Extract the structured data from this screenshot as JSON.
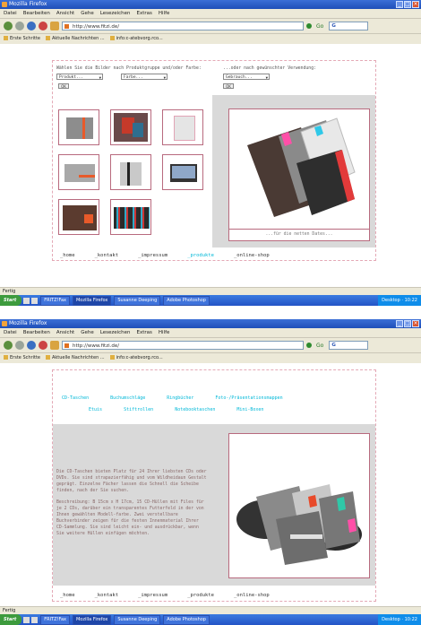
{
  "window": {
    "title": "Mozilla Firefox"
  },
  "menu": [
    "Datei",
    "Bearbeiten",
    "Ansicht",
    "Gehe",
    "Lesezeichen",
    "Extras",
    "Hilfe"
  ],
  "url": "http://www.fitzi.de/",
  "bookmarks": [
    "Erste Schritte",
    "Aktuelle Nachrichten ...",
    "",
    "info:c-atebvorg.rco..."
  ],
  "bookmarks2": [
    "Erste Schritte",
    "Aktuelle Nachrichten ...",
    "info:c-atebvorg.rco..."
  ],
  "status_label": "Fertig",
  "colors": {
    "accent_cyan": "#00b8d8",
    "frame_border": "#b86a7e",
    "dashed_border": "#e4a9b6",
    "taskbar": "#2454c6"
  },
  "screen1": {
    "filter_prompt": "Wählen Sie die Bilder nach Produktgruppe und/oder Farbe:",
    "filter_prompt2": "...oder nach gewünschter Verwendung:",
    "select_product": "Produkt...",
    "select_color": "Farbe...",
    "select_use": "Gebrauch...",
    "ok_label": "OK",
    "big_caption": "...für die netten Dates...",
    "nav": [
      "_home",
      "_kontakt",
      "_impressum",
      "_produkte",
      "_online-shop"
    ],
    "nav_active_index": 3
  },
  "screen2": {
    "cat_row1": [
      "CD-Taschen",
      "Buchumschläge",
      "Ringbücher",
      "Foto-/Präsentationsmappen"
    ],
    "cat_row2": [
      "Etuis",
      "Stiftrollen",
      "Notebooktaschen",
      "Mini-Boxen"
    ],
    "text_p1": "Die CD-Taschen bieten Platz für 24 Ihrer liebsten CDs oder DVDs. Sie sind strapazierfähig und vom Wildheidaun Gestalt geprägt. Einzelne Fächer lassen die Schnell die Scheibe finden, nach der Sie suchen.",
    "text_p2": "Beschreibung: B 15cm x H 17cm, 15 CD-Hüllen mit Files für je 2 CDs, darüber ein transparentes Futterfeld in der von Ihnen gewählten Modell-farbe. Zwei verstellbare Buchverbinder zeigen für die festen Innenmaterial Ihrer CD-Sammlung. Sie sind leicht ein- und ausdrückbar, wenn Sie weitere Hüllen einfügen möchten.",
    "nav": [
      "_home",
      "_kontakt",
      "_impressum",
      "_produkte",
      "_online-shop"
    ]
  },
  "taskbar": {
    "start": "Start",
    "tasks1": [
      "FRITZ!Fax",
      "Mozilla Firefox",
      "Susanne Deeping",
      "Adobe Photoshop"
    ],
    "tray1": "Desktop",
    "clock1": "10:22",
    "tasks2": [
      "FRITZ!Fax",
      "Mozilla Firefox",
      "Susanne Deeping",
      "Adobe Photoshop"
    ],
    "tray2": "Desktop",
    "clock2": "10:22"
  }
}
